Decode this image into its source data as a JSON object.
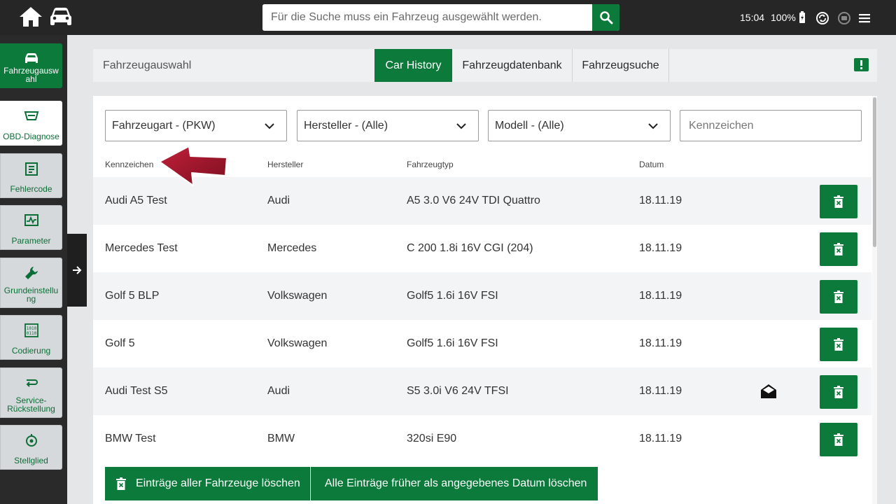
{
  "topbar": {
    "search_placeholder": "Für die Suche muss ein Fahrzeug ausgewählt werden.",
    "time": "15:04",
    "battery": "100%"
  },
  "sidebar": {
    "items": [
      {
        "label": "Fahrzeugausw\nahl",
        "icon": "car-icon"
      },
      {
        "label": "OBD-Diagnose",
        "icon": "obd-icon"
      },
      {
        "label": "Fehlercode",
        "icon": "fault-code-icon"
      },
      {
        "label": "Parameter",
        "icon": "parameter-icon"
      },
      {
        "label": "Grundeinstellu\nng",
        "icon": "wrench-icon"
      },
      {
        "label": "Codierung",
        "icon": "binary-icon"
      },
      {
        "label": "Service-\nRückstellung",
        "icon": "service-reset-icon"
      },
      {
        "label": "Stellglied",
        "icon": "actuator-icon"
      }
    ]
  },
  "tabbar": {
    "crumb": "Fahrzeugauswahl",
    "tabs": [
      "Car History",
      "Fahrzeugdatenbank",
      "Fahrzeugsuche"
    ]
  },
  "filters": {
    "type": "Fahrzeugart - (PKW)",
    "manufacturer": "Hersteller - (Alle)",
    "model": "Modell - (Alle)",
    "plate_placeholder": "Kennzeichen"
  },
  "table": {
    "headers": [
      "Kennzeichen",
      "Hersteller",
      "Fahrzeugtyp",
      "Datum"
    ],
    "rows": [
      {
        "plate": "Audi A5 Test",
        "maker": "Audi",
        "type": "A5 3.0 V6 24V TDI Quattro",
        "date": "18.11.19",
        "mail": false
      },
      {
        "plate": "Mercedes Test",
        "maker": "Mercedes",
        "type": "C 200 1.8i 16V CGI (204)",
        "date": "18.11.19",
        "mail": false
      },
      {
        "plate": "Golf 5 BLP",
        "maker": "Volkswagen",
        "type": "Golf5 1.6i 16V FSI",
        "date": "18.11.19",
        "mail": false
      },
      {
        "plate": "Golf 5",
        "maker": "Volkswagen",
        "type": "Golf5 1.6i 16V FSI",
        "date": "18.11.19",
        "mail": false
      },
      {
        "plate": "Audi Test S5",
        "maker": "Audi",
        "type": "S5 3.0i V6 24V TFSI",
        "date": "18.11.19",
        "mail": true
      },
      {
        "plate": "BMW Test",
        "maker": "BMW",
        "type": "320si E90",
        "date": "18.11.19",
        "mail": false
      }
    ]
  },
  "actions": {
    "delete_all": "Einträge aller Fahrzeuge löschen",
    "delete_before": "Alle Einträge früher als angegebenes Datum löschen"
  },
  "colors": {
    "accent": "#0b7a3b",
    "annotation_arrow": "#a01628"
  }
}
